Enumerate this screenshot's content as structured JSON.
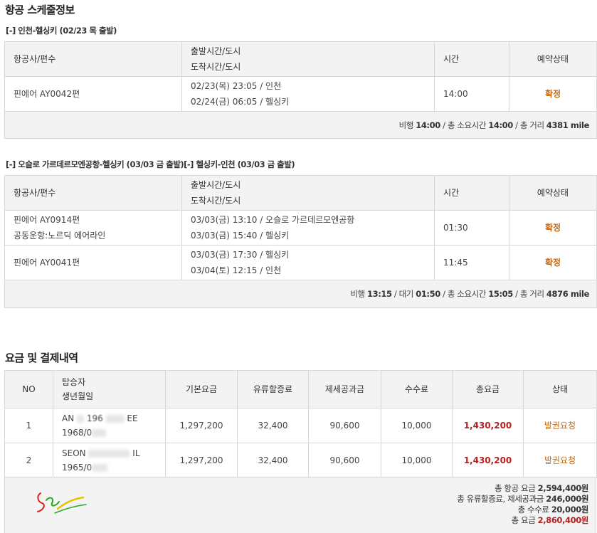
{
  "schedule": {
    "title": "항공 스케줄정보",
    "header": {
      "airline": "항공사/편수",
      "dep_time": "출발시간/도시",
      "arr_time": "도착시간/도시",
      "duration": "시간",
      "status": "예약상태"
    },
    "segment1": {
      "route": "[-] 인천-헬싱키 (02/23 목 출발)",
      "rows": [
        {
          "flight": "핀에어 AY0042편",
          "sub": "",
          "dep": "02/23(목) 23:05 / 인천",
          "arr": "02/24(금) 06:05 / 헬싱키",
          "time": "14:00",
          "status": "확정"
        }
      ],
      "footer": {
        "flight_label": "비행",
        "flight_time": "14:00",
        "total_label": "/ 총 소요시간",
        "total_time": "14:00",
        "dist_label": "/ 총 거리",
        "distance": "4381 mile"
      }
    },
    "segment2": {
      "route": "[-] 오슬로 가르데르모엔공항-헬싱키 (03/03 금 출발)[-] 헬싱키-인천 (03/03 금 출발)",
      "rows": [
        {
          "flight": "핀에어 AY0914편",
          "sub": "공동운항:노르딕 에어라인",
          "dep": "03/03(금) 13:10 / 오슬로 가르데르모엔공항",
          "arr": "03/03(금) 15:40 / 헬싱키",
          "time": "01:30",
          "status": "확정"
        },
        {
          "flight": "핀에어 AY0041편",
          "sub": "",
          "dep": "03/03(금) 17:30 / 헬싱키",
          "arr": "03/04(토) 12:15 / 인천",
          "time": "11:45",
          "status": "확정"
        }
      ],
      "footer": {
        "flight_label": "비행",
        "flight_time": "13:15",
        "wait_label": "/ 대기",
        "wait_time": "01:50",
        "total_label": "/ 총 소요시간",
        "total_time": "15:05",
        "dist_label": "/ 총 거리",
        "distance": "4876 mile"
      }
    }
  },
  "fare": {
    "title": "요금 및 결제내역",
    "header": {
      "no": "NO",
      "passenger": "탑승자",
      "birth": "생년월일",
      "base": "기본요금",
      "fuel": "유류할증료",
      "tax": "제세공과금",
      "fee": "수수료",
      "total": "총요금",
      "status": "상태"
    },
    "rows": [
      {
        "no": "1",
        "name_a": "AN",
        "name_b": "196",
        "name_c": "EE",
        "birth": "1968/0",
        "base": "1,297,200",
        "fuel": "32,400",
        "tax": "90,600",
        "fee": "10,000",
        "total": "1,430,200",
        "status": "발권요청"
      },
      {
        "no": "2",
        "name_a": "SEON",
        "name_b": "",
        "name_c": "IL",
        "birth": "1965/0",
        "base": "1,297,200",
        "fuel": "32,400",
        "tax": "90,600",
        "fee": "10,000",
        "total": "1,430,200",
        "status": "발권요청"
      }
    ],
    "summary": {
      "air_label": "총 항공 요금",
      "air_value": "2,594,400원",
      "fuel_tax_label": "총 유류할증료, 제세공과금",
      "fuel_tax_value": "246,000원",
      "fee_label": "총 수수료",
      "fee_value": "20,000원",
      "total_label": "총 요금",
      "total_value": "2,860,400원"
    }
  },
  "colors": {
    "confirm": "#c56a12",
    "total_red": "#b51f1f",
    "header_bg": "#f3f3f3",
    "border": "#d7d7d7"
  }
}
